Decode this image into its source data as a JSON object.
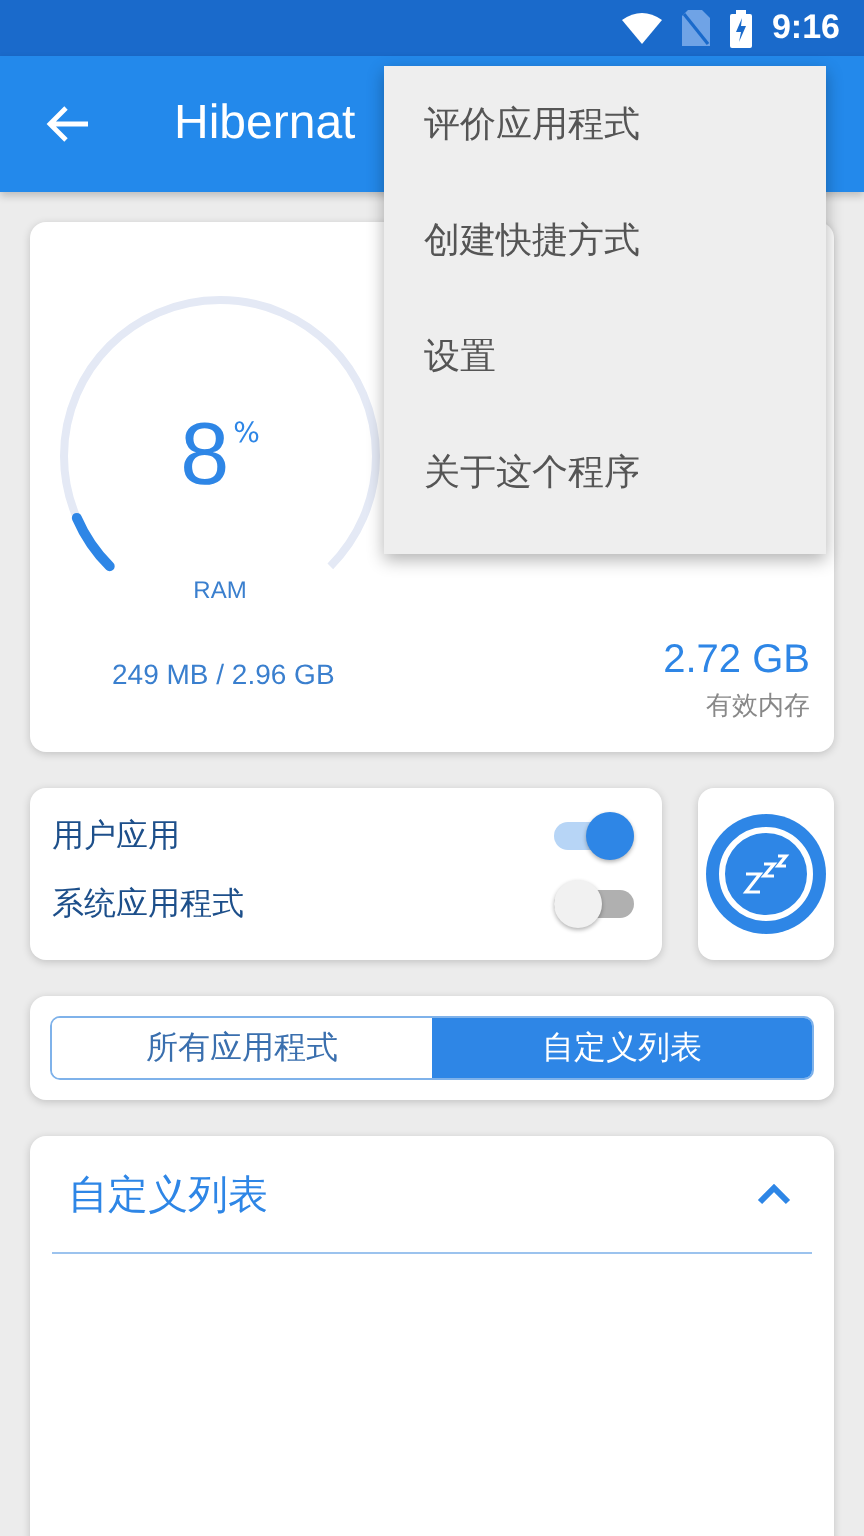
{
  "status_bar": {
    "time": "9:16"
  },
  "app_bar": {
    "title": "Hibernat"
  },
  "ram_card": {
    "percent": "8",
    "percent_unit": "%",
    "label": "RAM",
    "level": 0.08,
    "usage": "249 MB / 2.96 GB",
    "available": "2.72 GB",
    "available_label": "有效内存"
  },
  "filters": [
    {
      "label": "用户应用",
      "on": true
    },
    {
      "label": "系统应用程式",
      "on": false
    }
  ],
  "segments": [
    {
      "label": "所有应用程式",
      "selected": false
    },
    {
      "label": "自定义列表",
      "selected": true
    }
  ],
  "list_panel": {
    "title": "自定义列表",
    "expanded": true
  },
  "menu": {
    "items": [
      "评价应用程式",
      "创建快捷方式",
      "设置",
      "关于这个程序"
    ]
  }
}
